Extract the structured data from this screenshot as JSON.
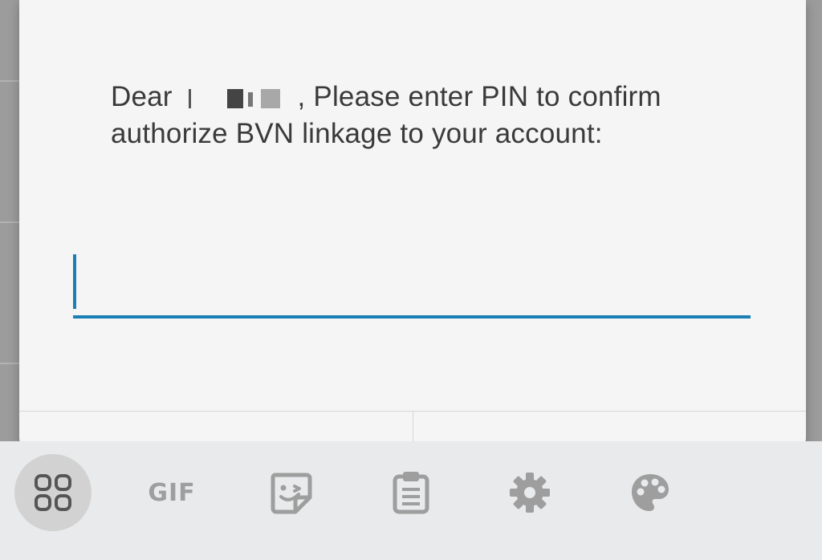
{
  "dialog": {
    "message_prefix": "Dear",
    "message_suffix": ", Please enter PIN to confirm authorize BVN linkage to your account:",
    "pin_value": "",
    "buttons": [
      "",
      ""
    ]
  },
  "keyboard_toolbar": {
    "items": [
      {
        "icon": "apps-grid-icon",
        "active": true
      },
      {
        "icon": "gif-icon",
        "label": "GIF"
      },
      {
        "icon": "sticker-icon"
      },
      {
        "icon": "clipboard-icon"
      },
      {
        "icon": "settings-gear-icon"
      },
      {
        "icon": "theme-palette-icon"
      }
    ]
  },
  "colors": {
    "accent": "#1a7fb5",
    "dialog_bg": "#f5f5f5",
    "toolbar_bg": "#e8eaeb",
    "icon_gray": "#9e9e9e",
    "icon_dark": "#555555"
  }
}
